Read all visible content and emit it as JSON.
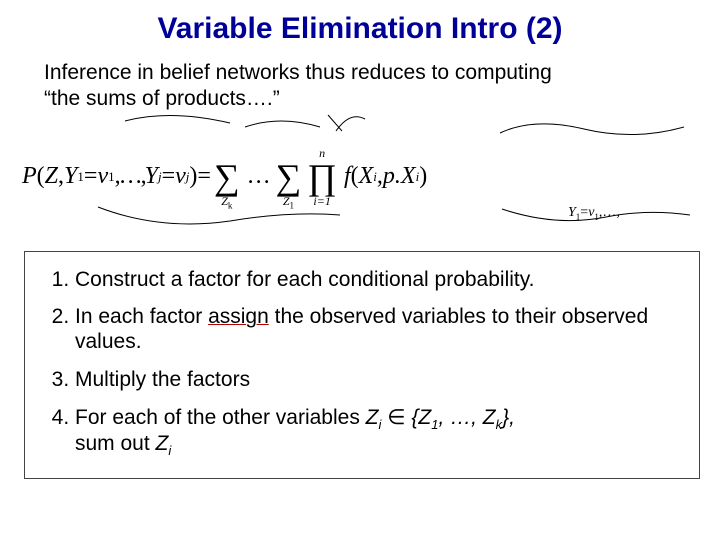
{
  "title": "Variable Elimination Intro (2)",
  "intro_line1": "Inference in belief networks thus reduces to computing",
  "intro_quote_open": "“",
  "intro_quote_body": "the sums of products….",
  "intro_quote_close": "”",
  "equation": {
    "lhs_P": "P",
    "lhs_open": "(",
    "lhs_Z": "Z",
    "lhs_comma1": ",",
    "lhs_Y1": "Y",
    "lhs_Y1sub": "1",
    "lhs_eq1": " = ",
    "lhs_v1": "v",
    "lhs_v1sub": "1",
    "lhs_dots": ",…,",
    "lhs_Yj": "Y",
    "lhs_Yjsub": "j",
    "lhs_eqj": " = ",
    "lhs_vj": "v",
    "lhs_vjsub": "j",
    "lhs_close": ")",
    "eqsign": " = ",
    "sumZk_top": "",
    "sumZk_bot": "Z",
    "sumZk_botsub": "k",
    "mid_dots": "…",
    "sumZ1_top": "",
    "sumZ1_bot": "Z",
    "sumZ1_botsub": "1",
    "prod_top": "n",
    "prod_bot": "i=1",
    "f": "f",
    "f_open": "(",
    "Xi": "X",
    "Xisub": "i",
    "fc": ", ",
    "pX": "p.X",
    "pXsub": "i",
    "f_close": ")"
  },
  "side_constraint": {
    "Y1": "Y",
    "Y1s": "1",
    "eq": "=",
    "v1": "v",
    "v1s": "1",
    "dots": ",…,"
  },
  "steps": {
    "s1": "Construct a factor for each conditional probability.",
    "s2a": "In each factor ",
    "s2assign": "assign",
    "s2b": " the observed variables to their observed values.",
    "s3": "Multiply the factors",
    "s4a": "For each of the other variables ",
    "s4zi": "Z",
    "s4zisub": "i",
    "s4in": " ∈ ",
    "s4set1": "{Z",
    "s4set1sub": "1",
    "s4mid": ", …, ",
    "s4setk": "Z",
    "s4setksub": "k",
    "s4setend": "},",
    "s4b": " sum out ",
    "s4zi2": "Z",
    "s4zi2sub": "i"
  }
}
